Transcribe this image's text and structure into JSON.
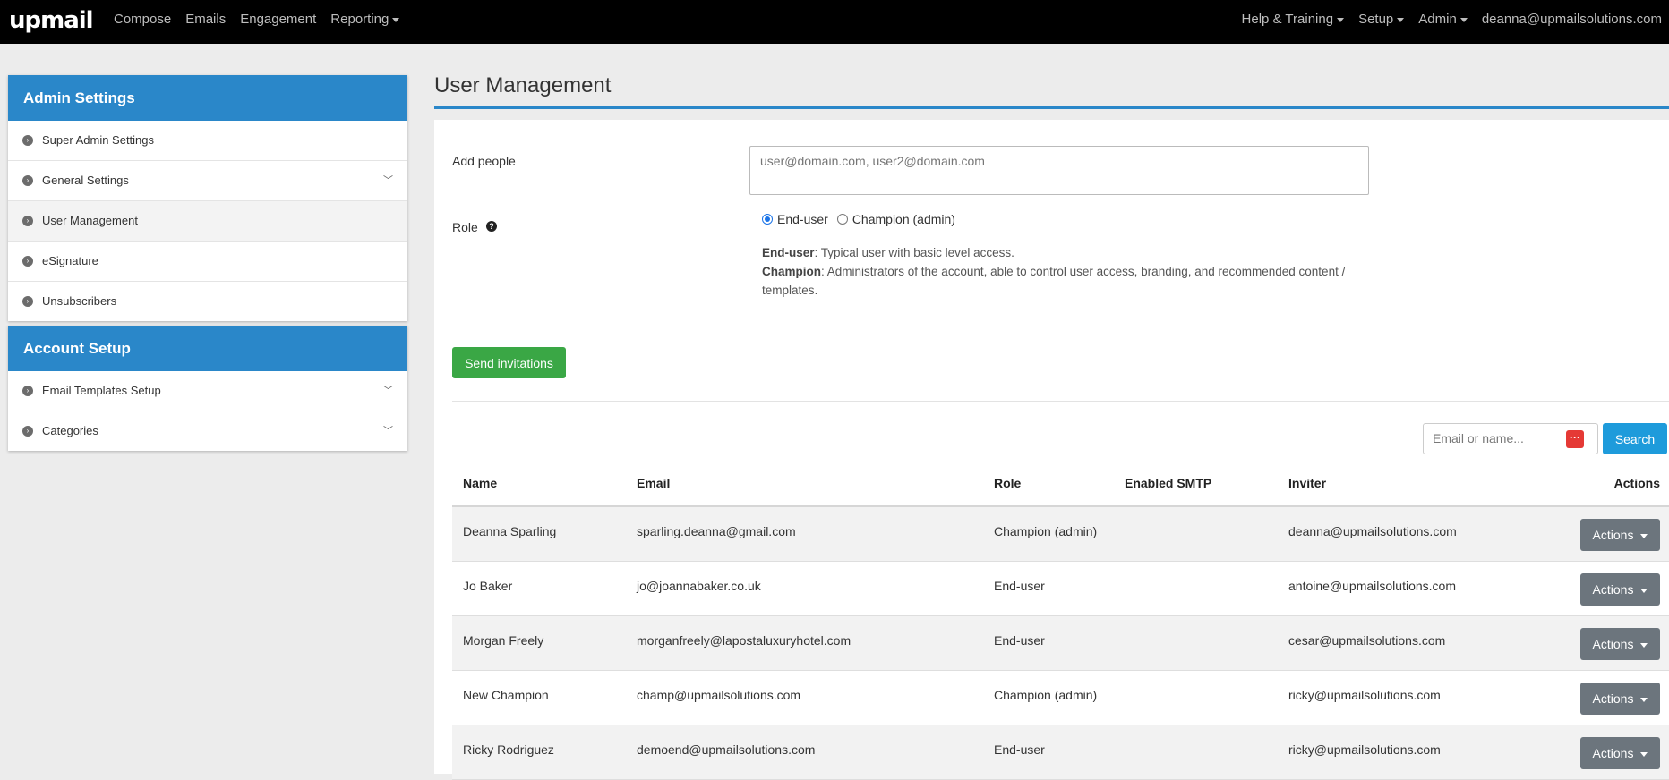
{
  "brand": {
    "logo": "upmail"
  },
  "nav": {
    "left": [
      "Compose",
      "Emails",
      "Engagement",
      "Reporting"
    ],
    "right": [
      "Help & Training",
      "Setup",
      "Admin"
    ],
    "user_email": "deanna@upmailsolutions.com"
  },
  "sidebar": {
    "admin": {
      "title": "Admin Settings",
      "items": [
        "Super Admin Settings",
        "General Settings",
        "User Management",
        "eSignature",
        "Unsubscribers"
      ]
    },
    "account": {
      "title": "Account Setup",
      "items": [
        "Email Templates Setup",
        "Categories"
      ]
    }
  },
  "main": {
    "title": "User Management",
    "add_people_label": "Add people",
    "add_people_placeholder": "user@domain.com, user2@domain.com",
    "role_label": "Role",
    "role_options": [
      "End-user",
      "Champion (admin)"
    ],
    "selected_role": "End-user",
    "desc": {
      "enduser_term": "End-user",
      "enduser_text": ": Typical user with basic level access.",
      "champion_term": "Champion",
      "champion_text": ": Administrators of the account, able to control user access, branding, and recommended content / templates."
    },
    "send_label": "Send invitations",
    "search_placeholder": "Email or name...",
    "search_label": "Search"
  },
  "table": {
    "headers": [
      "Name",
      "Email",
      "Role",
      "Enabled SMTP",
      "Inviter",
      "Actions"
    ],
    "action_label": "Actions",
    "rows": [
      {
        "name": "Deanna Sparling",
        "email": "sparling.deanna@gmail.com",
        "role": "Champion (admin)",
        "smtp": "",
        "inviter": "deanna@upmailsolutions.com"
      },
      {
        "name": "Jo Baker",
        "email": "jo@joannabaker.co.uk",
        "role": "End-user",
        "smtp": "",
        "inviter": "antoine@upmailsolutions.com"
      },
      {
        "name": "Morgan Freely",
        "email": "morganfreely@lapostaluxuryhotel.com",
        "role": "End-user",
        "smtp": "",
        "inviter": "cesar@upmailsolutions.com"
      },
      {
        "name": "New Champion",
        "email": "champ@upmailsolutions.com",
        "role": "Champion (admin)",
        "smtp": "",
        "inviter": "ricky@upmailsolutions.com"
      },
      {
        "name": "Ricky Rodriguez",
        "email": "demoend@upmailsolutions.com",
        "role": "End-user",
        "smtp": "",
        "inviter": "ricky@upmailsolutions.com"
      }
    ]
  },
  "colors": {
    "nav_bg": "#000000",
    "panel_header": "#2a87c9",
    "send_button": "#3aa745",
    "search_button": "#1e9bdb",
    "actions_button": "#6c757d"
  }
}
